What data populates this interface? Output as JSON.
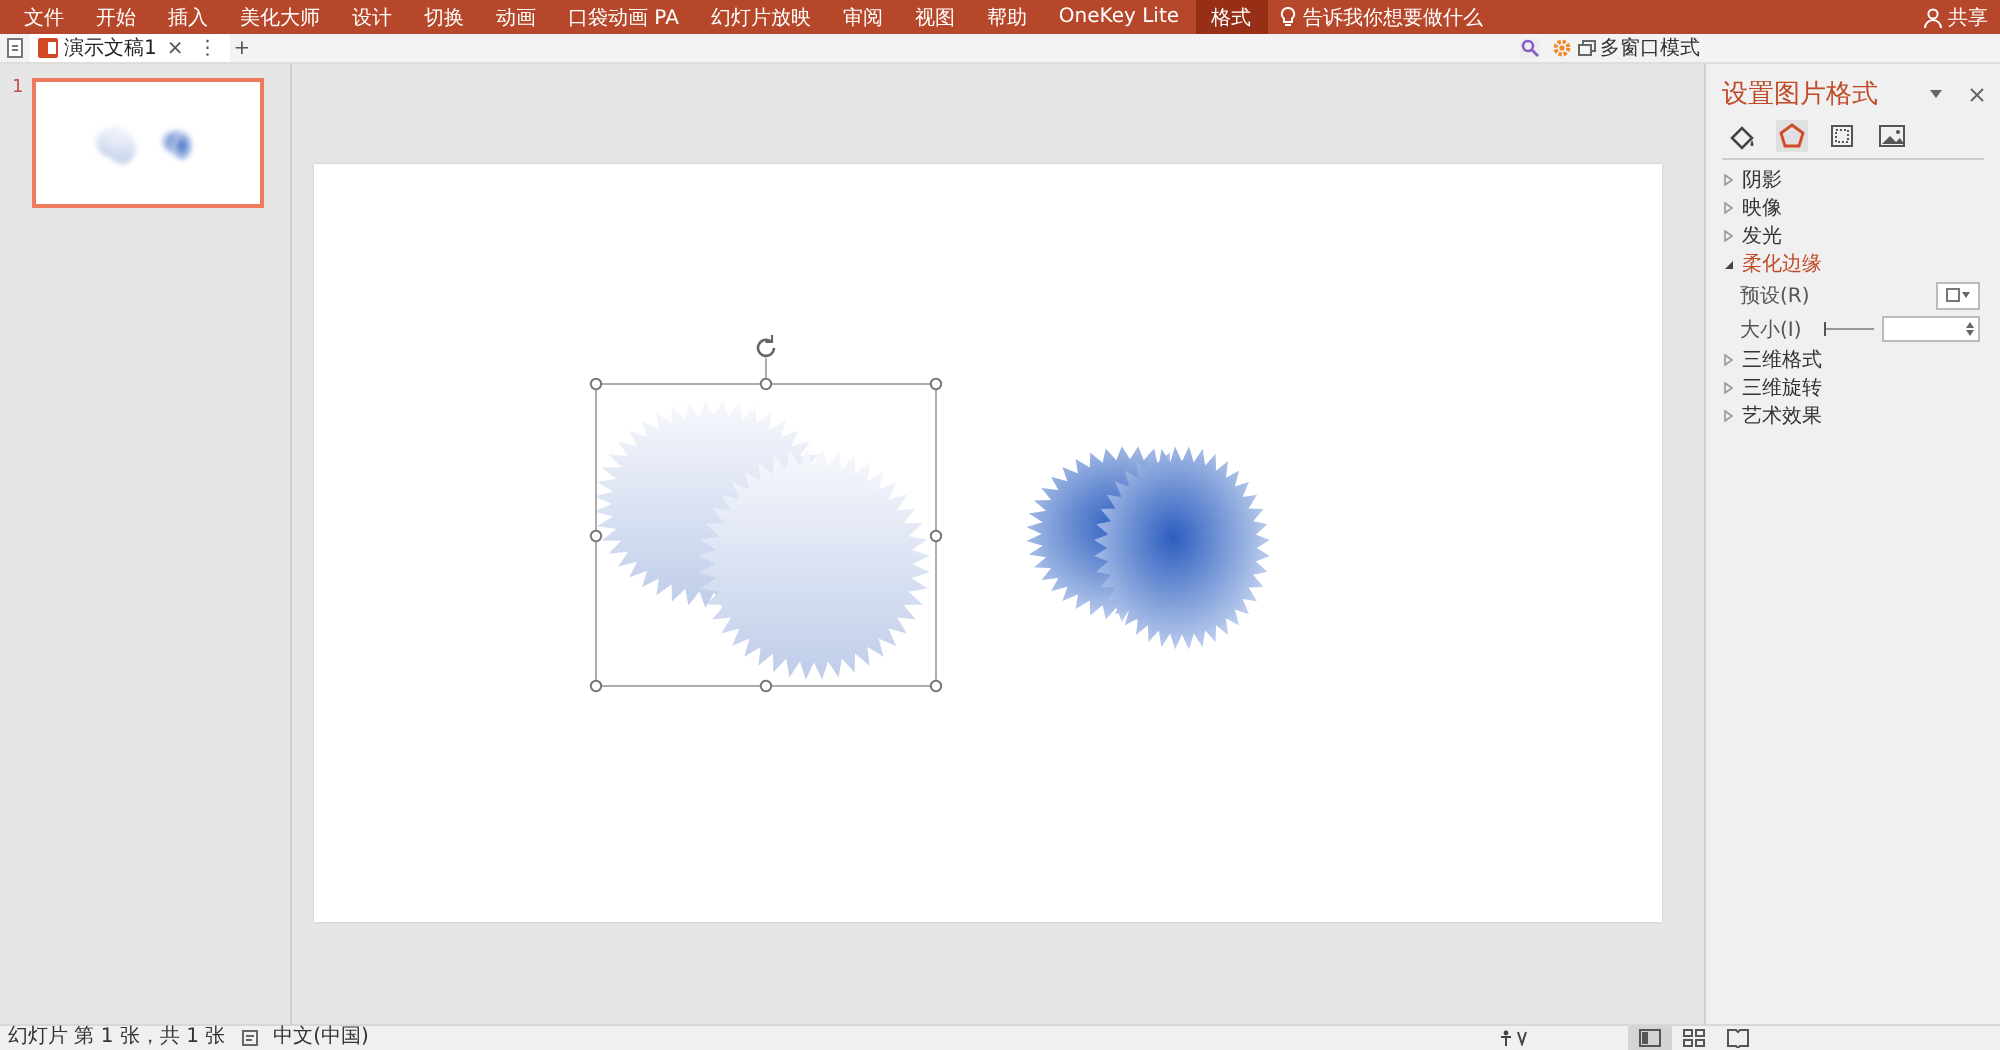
{
  "menu_bar": {
    "tabs": [
      {
        "label": "文件",
        "selected": false
      },
      {
        "label": "开始",
        "selected": false
      },
      {
        "label": "插入",
        "selected": false
      },
      {
        "label": "美化大师",
        "selected": false
      },
      {
        "label": "设计",
        "selected": false
      },
      {
        "label": "切换",
        "selected": false
      },
      {
        "label": "动画",
        "selected": false
      },
      {
        "label": "口袋动画 PA",
        "selected": false
      },
      {
        "label": "幻灯片放映",
        "selected": false
      },
      {
        "label": "审阅",
        "selected": false
      },
      {
        "label": "视图",
        "selected": false
      },
      {
        "label": "帮助",
        "selected": false
      },
      {
        "label": "OneKey Lite",
        "selected": false
      },
      {
        "label": "格式",
        "selected": true
      }
    ],
    "search_hint": "告诉我你想要做什么",
    "share": "共享"
  },
  "document_tabs": {
    "tabs": [
      {
        "label": "演示文稿1",
        "selected": true
      }
    ],
    "close": "×",
    "more": "⋮",
    "add": "+",
    "multi_window": "多窗口模式"
  },
  "thumbnails": [
    {
      "number": "1",
      "selected": true
    }
  ],
  "format_panel": {
    "title": "设置图片格式",
    "icons": [
      {
        "kind": "fill",
        "selected": false
      },
      {
        "kind": "effects",
        "selected": true
      },
      {
        "kind": "size",
        "selected": false
      },
      {
        "kind": "picture",
        "selected": false
      }
    ],
    "sections": [
      {
        "label": "阴影",
        "expanded": false
      },
      {
        "label": "映像",
        "expanded": false
      },
      {
        "label": "发光",
        "expanded": false
      },
      {
        "label": "柔化边缘",
        "expanded": true,
        "preset_label": "预设(R)",
        "size_label": "大小(I)",
        "level": 0
      },
      {
        "label": "三维格式",
        "expanded": false
      },
      {
        "label": "三维旋转",
        "expanded": false
      },
      {
        "label": "艺术效果",
        "expanded": false
      }
    ]
  },
  "status_bar": {
    "slide_info": "幻灯片 第 1 张，共 1 张",
    "language": "中文(中国)",
    "views": [
      {
        "kind": "normal",
        "selected": true
      },
      {
        "kind": "sorter",
        "selected": false
      },
      {
        "kind": "reading",
        "selected": false
      }
    ]
  }
}
